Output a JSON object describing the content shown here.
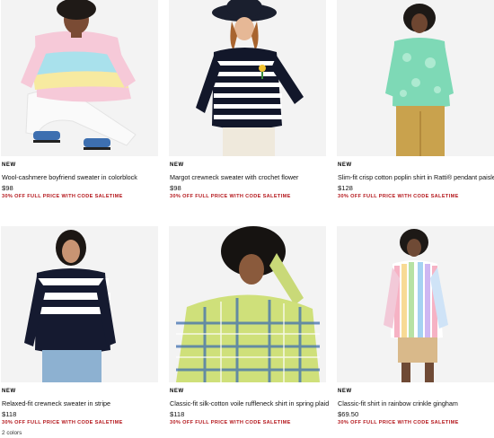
{
  "products": [
    {
      "badge": "NEW",
      "title": "Wool-cashmere boyfriend sweater in colorblock",
      "price": "$98",
      "promo": "30% OFF FULL PRICE WITH CODE SALETIME",
      "image": "woman-sweater-colorblock"
    },
    {
      "badge": "NEW",
      "title": "Margot crewneck sweater with crochet flower",
      "price": "$98",
      "promo": "30% OFF FULL PRICE WITH CODE SALETIME",
      "image": "woman-striped-sweater-hat"
    },
    {
      "badge": "NEW",
      "title": "Slim-fit crisp cotton poplin shirt in Ratti® pendant paisley",
      "price": "$128",
      "promo": "30% OFF FULL PRICE WITH CODE SALETIME",
      "image": "woman-green-paisley-shirt"
    },
    {
      "badge": "NEW",
      "title": "Relaxed-fit crewneck sweater in stripe",
      "price": "$118",
      "promo": "30% OFF FULL PRICE WITH CODE SALETIME",
      "colors": "2 colors",
      "image": "woman-navy-stripe-sweater"
    },
    {
      "badge": "NEW",
      "title": "Classic-fit silk-cotton voile ruffleneck shirt in spring plaid",
      "price": "$118",
      "promo": "30% OFF FULL PRICE WITH CODE SALETIME",
      "image": "woman-plaid-shirt"
    },
    {
      "badge": "NEW",
      "title": "Classic-fit shirt in rainbow crinkle gingham",
      "price": "$69.50",
      "promo": "30% OFF FULL PRICE WITH CODE SALETIME",
      "image": "woman-rainbow-gingham-shirt"
    }
  ],
  "colors": {
    "promo_red": "#b4161b",
    "photo_bg": "#f2f2f2"
  }
}
